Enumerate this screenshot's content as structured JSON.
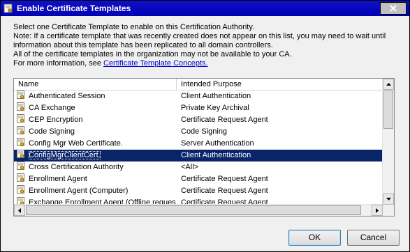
{
  "window": {
    "title": "Enable Certificate Templates"
  },
  "description": {
    "lines": [
      "Select one Certificate Template to enable on this Certification Authority.",
      "Note: If a certificate template that was recently created does not appear on this list, you may need to wait until",
      "information about this template has been replicated to all domain controllers.",
      "All of the certificate templates in the organization may not be available to your CA."
    ],
    "more_info_prefix": "For more information, see ",
    "more_info_link": "Certificate Template Concepts."
  },
  "list": {
    "columns": [
      "Name",
      "Intended Purpose"
    ],
    "rows": [
      {
        "name": "Authenticated Session",
        "purpose": "Client Authentication"
      },
      {
        "name": "CA Exchange",
        "purpose": "Private Key Archival"
      },
      {
        "name": "CEP Encryption",
        "purpose": "Certificate Request Agent"
      },
      {
        "name": "Code Signing",
        "purpose": "Code Signing"
      },
      {
        "name": "Config Mgr Web Certificate.",
        "purpose": "Server Authentication"
      },
      {
        "name": "ConfigMgrClientCert.",
        "purpose": "Client Authentication",
        "selected": true
      },
      {
        "name": "Cross Certification Authority",
        "purpose": "<All>"
      },
      {
        "name": "Enrollment Agent",
        "purpose": "Certificate Request Agent"
      },
      {
        "name": "Enrollment Agent (Computer)",
        "purpose": "Certificate Request Agent"
      },
      {
        "name": "Exchange Enrollment Agent (Offline request)",
        "purpose": "Certificate Request Agent"
      }
    ]
  },
  "buttons": {
    "ok": "OK",
    "cancel": "Cancel"
  },
  "icons": {
    "title": "certificate-icon",
    "row": "certificate-template-icon"
  },
  "colors": {
    "titlebar": "#0000b4",
    "selection": "#0a246a",
    "link": "#0000cc"
  }
}
